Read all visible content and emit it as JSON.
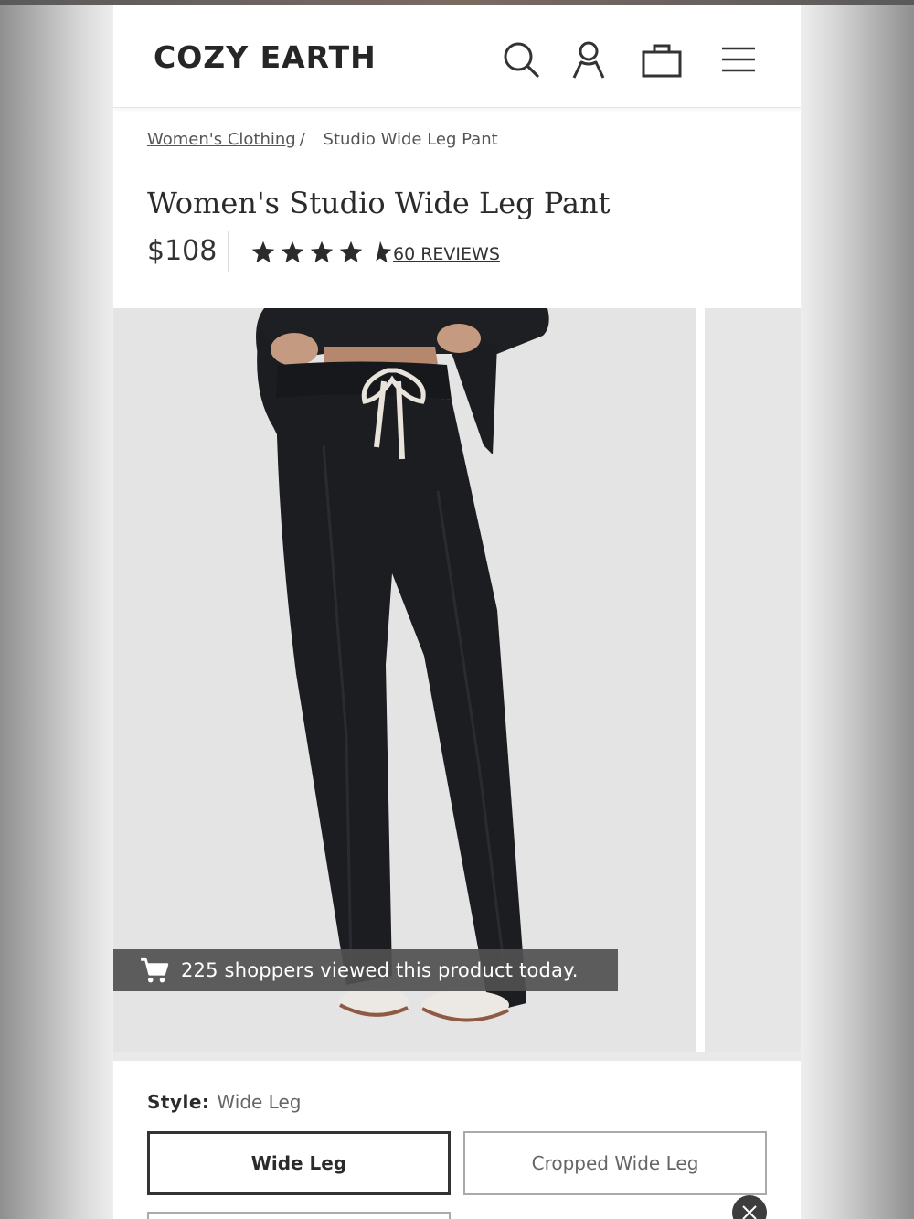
{
  "header": {
    "logo": "COZY EARTH",
    "icons": [
      "search-icon",
      "account-icon",
      "bag-icon",
      "menu-icon"
    ]
  },
  "breadcrumb": {
    "parent": "Women's Clothing",
    "separator": "/",
    "current": "Studio Wide Leg Pant"
  },
  "product": {
    "title": "Women's Studio Wide Leg Pant",
    "price": "$108",
    "rating": 4.5,
    "rating_max": 5,
    "reviews_label": "60 REVIEWS"
  },
  "gallery": {
    "banner_text": "225 shoppers viewed this product today.",
    "banner_icon": "cart-icon"
  },
  "style": {
    "label": "Style:",
    "selected_value": "Wide Leg",
    "options": [
      "Wide Leg",
      "Cropped Wide Leg"
    ]
  },
  "colors": {
    "text": "#2b2b2b",
    "banner_bg": "#505050",
    "selected_border": "#333333"
  }
}
